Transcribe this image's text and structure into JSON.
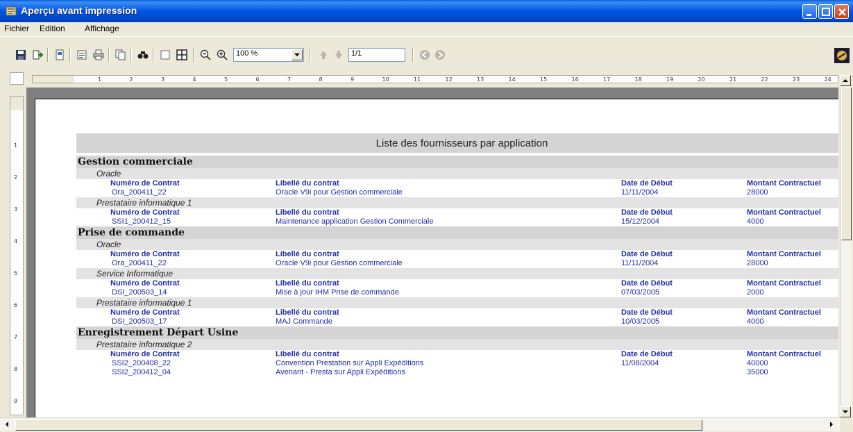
{
  "window": {
    "title": "Aperçu avant impression"
  },
  "menu": [
    "Fichier",
    "Edition",
    "Affichage"
  ],
  "toolbar": {
    "zoom_value": "100 %",
    "page_value": "1/1"
  },
  "ruler": {
    "h_ticks": [
      "1",
      "2",
      "3",
      "4",
      "5",
      "6",
      "7",
      "8",
      "9",
      "10",
      "11",
      "12",
      "13",
      "14",
      "15",
      "16",
      "17",
      "18",
      "19",
      "20",
      "21",
      "22",
      "23",
      "24"
    ],
    "v_ticks": [
      "1",
      "2",
      "3",
      "4",
      "5",
      "6",
      "7",
      "8",
      "9"
    ]
  },
  "report": {
    "title": "Liste des fournisseurs par application",
    "col_headers": {
      "contract_no": "Numéro de Contrat",
      "label": "Libellé du contrat",
      "start_date": "Date de Début",
      "amount": "Montant Contractuel"
    },
    "groups": [
      {
        "name": "Gestion commerciale",
        "suppliers": [
          {
            "name": "Oracle",
            "rows": [
              {
                "contract_no": "Ora_200411_22",
                "label": "Oracle V9i pour Gestion commerciale",
                "start_date": "11/11/2004",
                "amount": "28000"
              }
            ]
          },
          {
            "name": "Prestataire informatique 1",
            "rows": [
              {
                "contract_no": "SSI1_200412_15",
                "label": "Maintenance application Gestion Commerciale",
                "start_date": "15/12/2004",
                "amount": "4000"
              }
            ]
          }
        ]
      },
      {
        "name": "Prise de commande",
        "suppliers": [
          {
            "name": "Oracle",
            "rows": [
              {
                "contract_no": "Ora_200411_22",
                "label": "Oracle V9i pour Gestion commerciale",
                "start_date": "11/11/2004",
                "amount": "28000"
              }
            ]
          },
          {
            "name": "Service Informatique",
            "rows": [
              {
                "contract_no": "DSI_200503_14",
                "label": "Mise à jour IHM Prise de commande",
                "start_date": "07/03/2005",
                "amount": "2000"
              }
            ]
          },
          {
            "name": "Prestataire informatique 1",
            "rows": [
              {
                "contract_no": "DSI_200503_17",
                "label": "MAJ Commande",
                "start_date": "10/03/2005",
                "amount": "4000"
              }
            ]
          }
        ]
      },
      {
        "name": "Enregistrement Départ Usine",
        "suppliers": [
          {
            "name": "Prestataire informatique 2",
            "rows": [
              {
                "contract_no": "SSI2_200408_22",
                "label": "Convention Prestation sur Appli Expéditions",
                "start_date": "11/08/2004",
                "amount": "40000"
              },
              {
                "contract_no": "SSI2_200412_04",
                "label": "Avenant - Presta sur Appli Expéditions",
                "start_date": "",
                "amount": "35000"
              }
            ]
          }
        ]
      }
    ]
  }
}
